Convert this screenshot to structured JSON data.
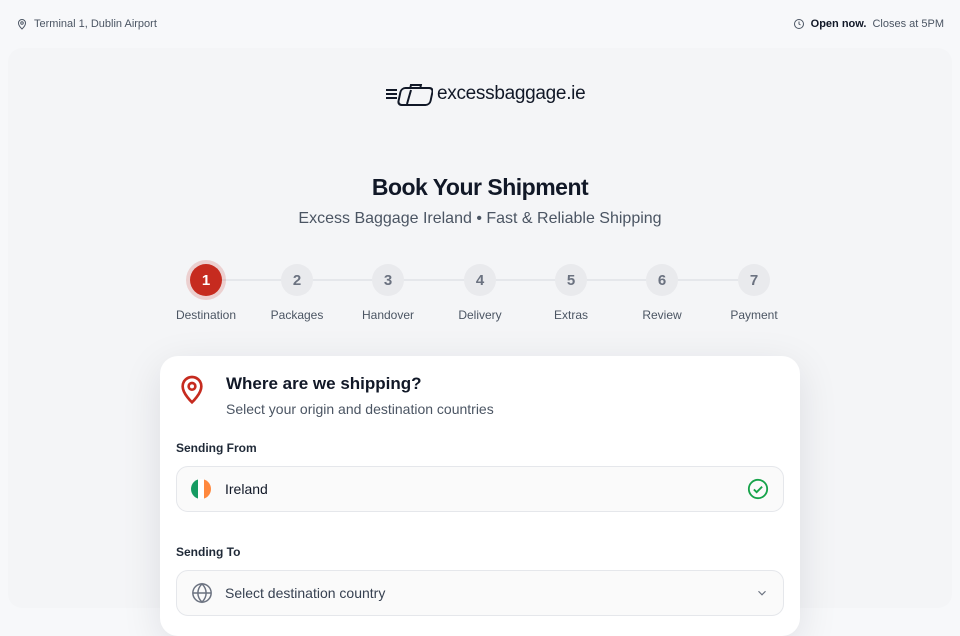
{
  "topbar": {
    "location": "Terminal 1, Dublin Airport",
    "status_bold": "Open now.",
    "status_rest": "Closes at 5PM",
    "location_icon": "map-pin-icon",
    "clock_icon": "clock-icon"
  },
  "logo": {
    "text": "excessbaggage.ie",
    "icon": "suitcase-speed-icon"
  },
  "page": {
    "title": "Book Your Shipment",
    "subtitle": "Excess Baggage Ireland • Fast & Reliable Shipping"
  },
  "steps": [
    {
      "number": "1",
      "label": "Destination"
    },
    {
      "number": "2",
      "label": "Packages"
    },
    {
      "number": "3",
      "label": "Handover"
    },
    {
      "number": "4",
      "label": "Delivery"
    },
    {
      "number": "5",
      "label": "Extras"
    },
    {
      "number": "6",
      "label": "Review"
    },
    {
      "number": "7",
      "label": "Payment"
    }
  ],
  "active_step": 1,
  "card": {
    "title": "Where are we shipping?",
    "subtitle": "Select your origin and destination countries",
    "from_label": "Sending From",
    "from_value": "Ireland",
    "to_label": "Sending To",
    "to_placeholder": "Select destination country"
  },
  "colors": {
    "accent": "#c62b1f",
    "success": "#16a34a"
  }
}
